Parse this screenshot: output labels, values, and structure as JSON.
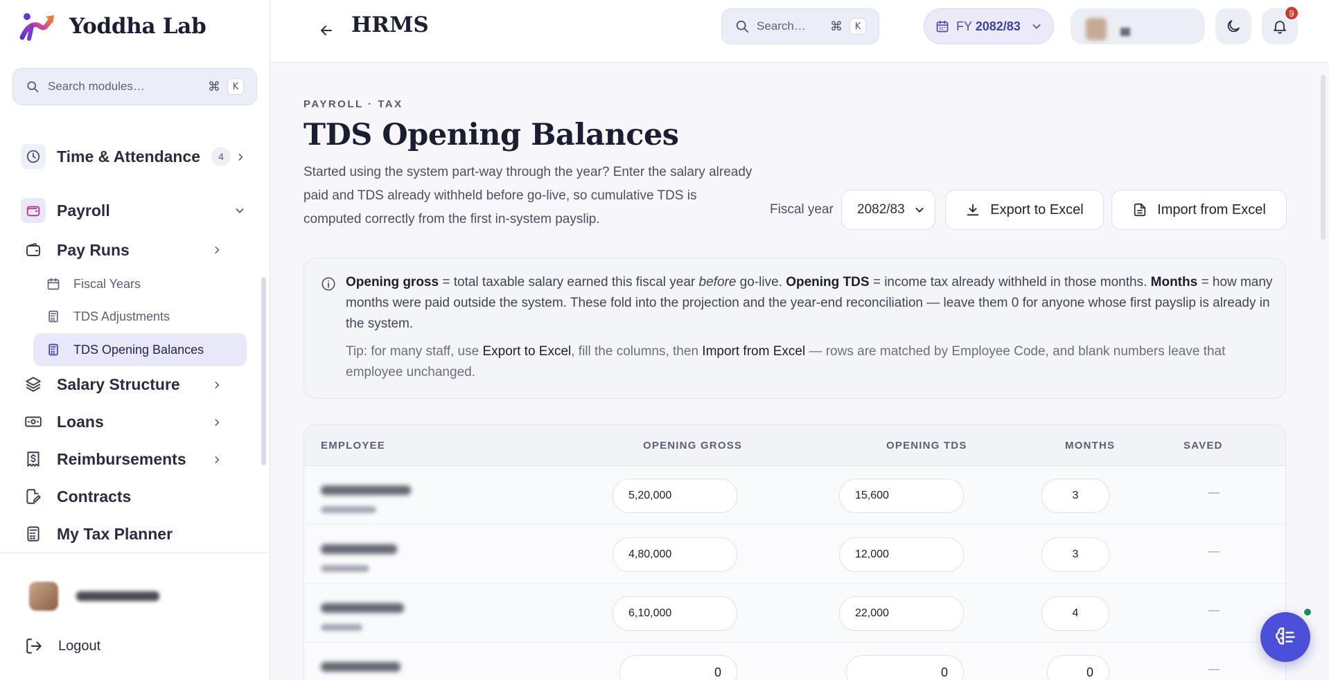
{
  "brand": {
    "name": "Yoddha Lab"
  },
  "sidebar": {
    "search": {
      "label": "Search modules…",
      "key1": "⌘",
      "key2": "K"
    },
    "items": [
      {
        "label": "Time & Attendance",
        "count": "4"
      },
      {
        "label": "Payroll"
      },
      {
        "label": "Pay Runs"
      },
      {
        "label": "Fiscal Years"
      },
      {
        "label": "TDS Adjustments"
      },
      {
        "label": "TDS Opening Balances"
      },
      {
        "label": "Salary Structure"
      },
      {
        "label": "Loans"
      },
      {
        "label": "Reimbursements"
      },
      {
        "label": "Contracts"
      },
      {
        "label": "My Tax Planner"
      }
    ],
    "logout": "Logout"
  },
  "topbar": {
    "title": "HRMS",
    "search": {
      "label": "Search…",
      "key1": "⌘",
      "key2": "K"
    },
    "fy_prefix": "FY",
    "fy_value": "2082/83",
    "notifications_count": "9"
  },
  "page": {
    "eyebrow": "PAYROLL · TAX",
    "title": "TDS Opening Balances",
    "description": "Started using the system part-way through the year? Enter the salary already paid and TDS already withheld before go-live, so cumulative TDS is computed correctly from the first in-system payslip.",
    "fiscal_year_label": "Fiscal year",
    "fiscal_year_value": "2082/83",
    "export_label": "Export to Excel",
    "import_label": "Import from Excel"
  },
  "info": {
    "t1": "Opening gross",
    "t2": " = total taxable salary earned this fiscal year ",
    "t3": "before",
    "t4": " go-live. ",
    "t5": "Opening TDS",
    "t6": " = income tax already withheld in those months. ",
    "t7": "Months",
    "t8": " = how many months were paid outside the system. These fold into the projection and the year-end reconciliation — leave them 0 for anyone whose first payslip is already in the system.",
    "tip1": "Tip: for many staff, use ",
    "tip2": "Export to Excel",
    "tip3": ", fill the columns, then ",
    "tip4": "Import from Excel",
    "tip5": " — rows are matched by Employee Code, and blank numbers leave that employee unchanged."
  },
  "table": {
    "headers": [
      "EMPLOYEE",
      "OPENING GROSS",
      "OPENING TDS",
      "MONTHS",
      "SAVED"
    ],
    "rows": [
      {
        "gross": "5,20,000",
        "tds": "15,600",
        "months": "3",
        "saved": "—"
      },
      {
        "gross": "4,80,000",
        "tds": "12,000",
        "months": "3",
        "saved": "—"
      },
      {
        "gross": "6,10,000",
        "tds": "22,000",
        "months": "4",
        "saved": "—"
      },
      {
        "gross": "0",
        "tds": "0",
        "months": "0",
        "saved": "—"
      }
    ]
  },
  "colors": {
    "accent": "#4c4fd8",
    "badge": "#d33a2f",
    "active_bg": "#e9e8fb"
  }
}
